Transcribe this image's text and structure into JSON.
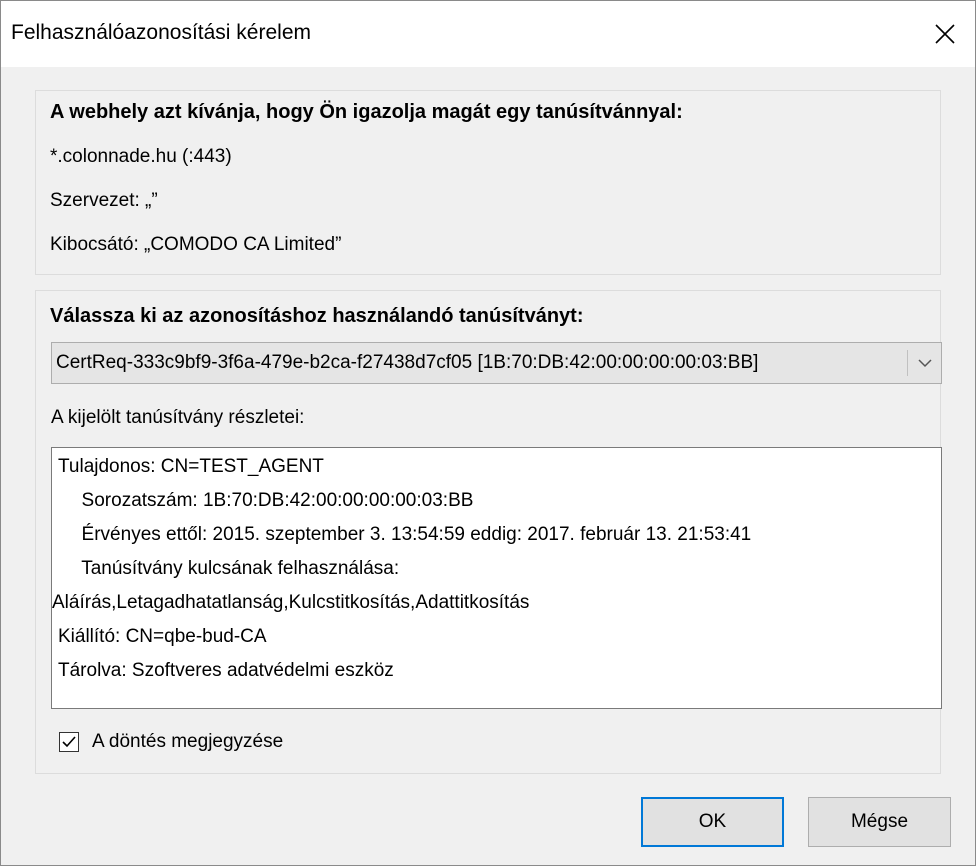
{
  "window": {
    "title": "Felhasználóazonosítási kérelem"
  },
  "site_info": {
    "heading": "A webhely azt kívánja, hogy Ön igazolja magát egy tanúsítvánnyal:",
    "host": "*.colonnade.hu (:443)",
    "organization": "Szervezet: „”",
    "issuer": "Kibocsátó: „COMODO CA Limited”"
  },
  "certificate": {
    "heading": "Válassza ki az azonosításhoz használandó tanúsítványt:",
    "selected": "CertReq-333c9bf9-3f6a-479e-b2ca-f27438d7cf05 [1B:70:DB:42:00:00:00:00:03:BB]",
    "details_label": "A kijelölt tanúsítvány részletei:",
    "details_lines": [
      "Tulajdonos: CN=TEST_AGENT",
      "  Sorozatszám: 1B:70:DB:42:00:00:00:00:03:BB",
      "  Érvényes ettől: 2015. szeptember 3. 13:54:59 eddig: 2017. február 13. 21:53:41",
      "  Tanúsítvány kulcsának felhasználása:",
      "Aláírás,Letagadhatatlanság,Kulcstitkosítás,Adattitkosítás",
      "Kiállító: CN=qbe-bud-CA",
      "Tárolva: Szoftveres adatvédelmi eszköz"
    ],
    "remember_label": "A döntés megjegyzése",
    "remember_checked": true
  },
  "buttons": {
    "ok": "OK",
    "cancel": "Mégse"
  },
  "icons": {
    "close": "close-icon",
    "dropdown": "chevron-down-icon",
    "checkmark": "checkmark-icon"
  },
  "colors": {
    "accent": "#0078d7",
    "dialog_bg": "#f0f0f0"
  }
}
